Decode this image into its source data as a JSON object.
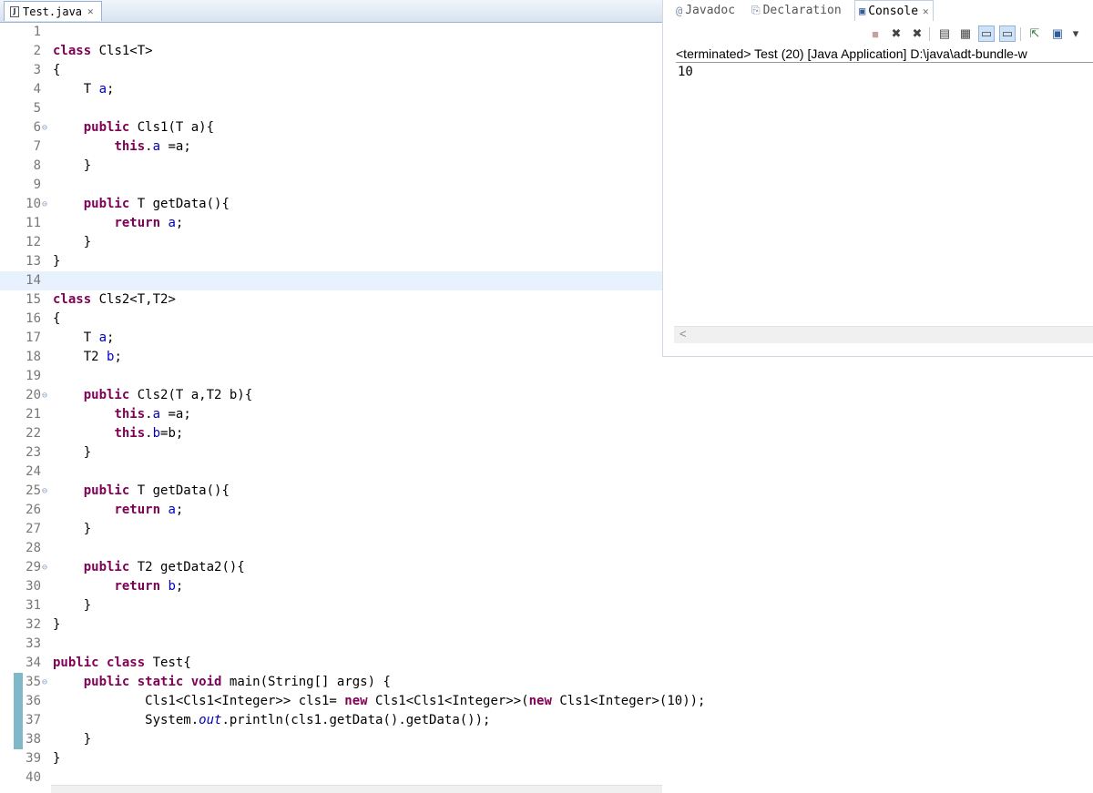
{
  "editor": {
    "tab_label": "Test.java",
    "tab_icon": "java-file-icon",
    "lines": [
      {
        "n": "1",
        "t": ""
      },
      {
        "n": "2",
        "t": "class Cls1<T>"
      },
      {
        "n": "3",
        "t": "{"
      },
      {
        "n": "4",
        "t": "    T a;"
      },
      {
        "n": "5",
        "t": ""
      },
      {
        "n": "6",
        "t": "    public Cls1(T a){",
        "fold": true
      },
      {
        "n": "7",
        "t": "        this.a =a;"
      },
      {
        "n": "8",
        "t": "    }"
      },
      {
        "n": "9",
        "t": ""
      },
      {
        "n": "10",
        "t": "    public T getData(){",
        "fold": true
      },
      {
        "n": "11",
        "t": "        return a;"
      },
      {
        "n": "12",
        "t": "    }"
      },
      {
        "n": "13",
        "t": "}"
      },
      {
        "n": "14",
        "t": "",
        "current": true
      },
      {
        "n": "15",
        "t": "class Cls2<T,T2>"
      },
      {
        "n": "16",
        "t": "{"
      },
      {
        "n": "17",
        "t": "    T a;"
      },
      {
        "n": "18",
        "t": "    T2 b;"
      },
      {
        "n": "19",
        "t": ""
      },
      {
        "n": "20",
        "t": "    public Cls2(T a,T2 b){",
        "fold": true
      },
      {
        "n": "21",
        "t": "        this.a =a;"
      },
      {
        "n": "22",
        "t": "        this.b=b;"
      },
      {
        "n": "23",
        "t": "    }"
      },
      {
        "n": "24",
        "t": ""
      },
      {
        "n": "25",
        "t": "    public T getData(){",
        "fold": true
      },
      {
        "n": "26",
        "t": "        return a;"
      },
      {
        "n": "27",
        "t": "    }"
      },
      {
        "n": "28",
        "t": ""
      },
      {
        "n": "29",
        "t": "    public T2 getData2(){",
        "fold": true
      },
      {
        "n": "30",
        "t": "        return b;"
      },
      {
        "n": "31",
        "t": "    }"
      },
      {
        "n": "32",
        "t": "}"
      },
      {
        "n": "33",
        "t": ""
      },
      {
        "n": "34",
        "t": "public class Test{"
      },
      {
        "n": "35",
        "t": "    public static void main(String[] args) {",
        "fold": true,
        "changed": true
      },
      {
        "n": "36",
        "t": "            Cls1<Cls1<Integer>> cls1= new Cls1<Cls1<Integer>>(new Cls1<Integer>(10));",
        "changed": true
      },
      {
        "n": "37",
        "t": "            System.out.println(cls1.getData().getData());",
        "changed": true
      },
      {
        "n": "38",
        "t": "    }",
        "changed": true
      },
      {
        "n": "39",
        "t": "}"
      },
      {
        "n": "40",
        "t": ""
      }
    ]
  },
  "views": {
    "tabs": [
      {
        "label": "Javadoc",
        "icon": "at-icon"
      },
      {
        "label": "Declaration",
        "icon": "declaration-icon"
      },
      {
        "label": "Console",
        "icon": "console-icon",
        "active": true
      }
    ],
    "toolbar_icons": [
      "terminate-icon",
      "remove-launch-icon",
      "remove-all-icon",
      "clear-console-icon",
      "scroll-lock-icon",
      "show-on-stdout-icon",
      "show-on-stderr-icon",
      "pin-console-icon",
      "display-console-icon",
      "dropdown-icon"
    ],
    "terminated_text": "<terminated> Test (20) [Java Application] D:\\java\\adt-bundle-w",
    "output": "10"
  }
}
